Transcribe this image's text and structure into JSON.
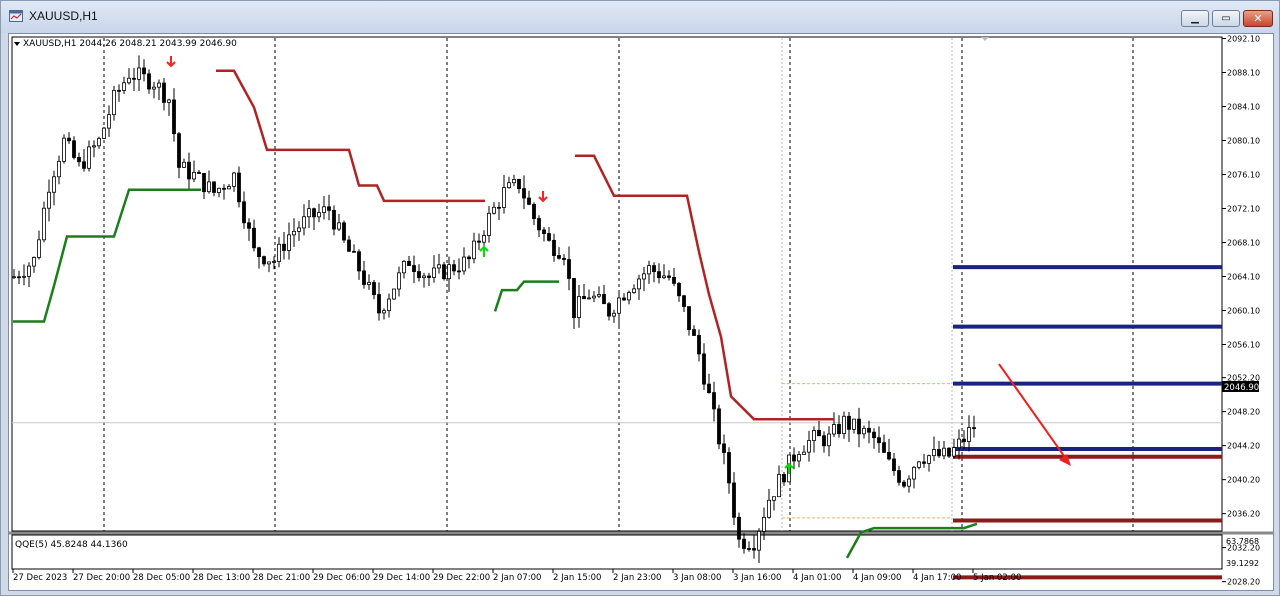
{
  "window": {
    "title": "XAUUSD,H1",
    "minimize_glyph": "▁",
    "maximize_glyph": "▭",
    "close_glyph": "✕"
  },
  "chart": {
    "header": "XAUUSD,H1  2044.26 2048.21 2043.99 2046.90",
    "current_price": "2046.90",
    "price_ticks": [
      "2092.10",
      "2088.10",
      "2084.10",
      "2080.10",
      "2076.10",
      "2072.10",
      "2068.10",
      "2064.10",
      "2060.10",
      "2056.10",
      "2052.20",
      "2048.20",
      "2044.20",
      "2040.20",
      "2036.20",
      "2032.20",
      "2028.20"
    ],
    "time_ticks": [
      "27 Dec 2023",
      "27 Dec 20:00",
      "28 Dec 05:00",
      "28 Dec 13:00",
      "28 Dec 21:00",
      "29 Dec 06:00",
      "29 Dec 14:00",
      "29 Dec 22:00",
      "2 Jan 07:00",
      "2 Jan 15:00",
      "2 Jan 23:00",
      "3 Jan 08:00",
      "3 Jan 16:00",
      "4 Jan 01:00",
      "4 Jan 09:00",
      "4 Jan 17:00",
      "5 Jan 02:00"
    ],
    "levels": [
      {
        "price": 2065.2,
        "color": "#1a237e"
      },
      {
        "price": 2058.2,
        "color": "#1a237e"
      },
      {
        "price": 2051.5,
        "color": "#1a237e"
      },
      {
        "price": 2043.8,
        "color": "#1a237e"
      },
      {
        "price": 2042.9,
        "color": "#8b1a1a"
      },
      {
        "price": 2035.4,
        "color": "#8b1a1a"
      },
      {
        "price": 2028.7,
        "color": "#8b1a1a"
      }
    ],
    "colors": {
      "resistance": "#b22222",
      "support": "#1a7f1a",
      "sell_arrow": "#ff2020",
      "buy_arrow": "#00e000"
    }
  },
  "indicator": {
    "header": "QQE(5) 45.8248 44.1360",
    "scale_top": "63.7868",
    "scale_bottom": "39.1292"
  }
}
